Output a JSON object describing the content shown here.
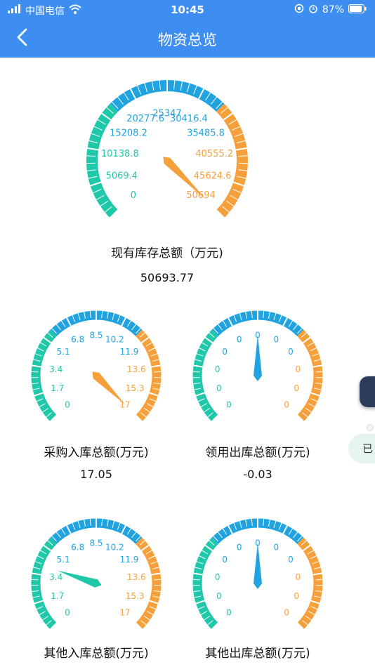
{
  "status_bar": {
    "carrier": "中国电信",
    "time": "10:45",
    "battery": "87%"
  },
  "nav": {
    "title": "物资总览",
    "back_icon": "chevron-left-icon"
  },
  "colors": {
    "teal": "#1ec8a8",
    "blue": "#21a3e0",
    "orange": "#f6a03b",
    "nav_bg": "#3d8ef0"
  },
  "gauges": [
    {
      "label": "现有库存总额（万元)",
      "value_text": "50693.77",
      "value": 50693.77,
      "max": 50694,
      "ticks": [
        "0",
        "5069.4",
        "10138.8",
        "15208.2",
        "20277.6",
        "25347",
        "30416.4",
        "35485.8",
        "40555.2",
        "45624.6",
        "50694"
      ]
    },
    {
      "label": "采购入库总额(万元)",
      "value_text": "17.05",
      "value": 17.05,
      "max": 17,
      "ticks": [
        "0",
        "1.7",
        "3.4",
        "5.1",
        "6.8",
        "8.5",
        "10.2",
        "11.9",
        "13.6",
        "15.3",
        "17"
      ]
    },
    {
      "label": "领用出库总额(万元)",
      "value_text": "-0.03",
      "value": 0,
      "max": 0,
      "ticks": [
        "0",
        "0",
        "0",
        "0",
        "0",
        "0",
        "0",
        "0",
        "0",
        "0",
        "0"
      ]
    },
    {
      "label": "其他入库总额(万元)",
      "value_text": "",
      "value": 4,
      "max": 17,
      "ticks": [
        "0",
        "1.7",
        "3.4",
        "5.1",
        "6.8",
        "8.5",
        "10.2",
        "11.9",
        "13.6",
        "15.3",
        "17"
      ]
    },
    {
      "label": "其他出库总额(万元)",
      "value_text": "",
      "value": 0,
      "max": 0,
      "ticks": [
        "0",
        "0",
        "0",
        "0",
        "0",
        "0",
        "0",
        "0",
        "0",
        "0",
        "0"
      ]
    }
  ],
  "side_tag": "已"
}
